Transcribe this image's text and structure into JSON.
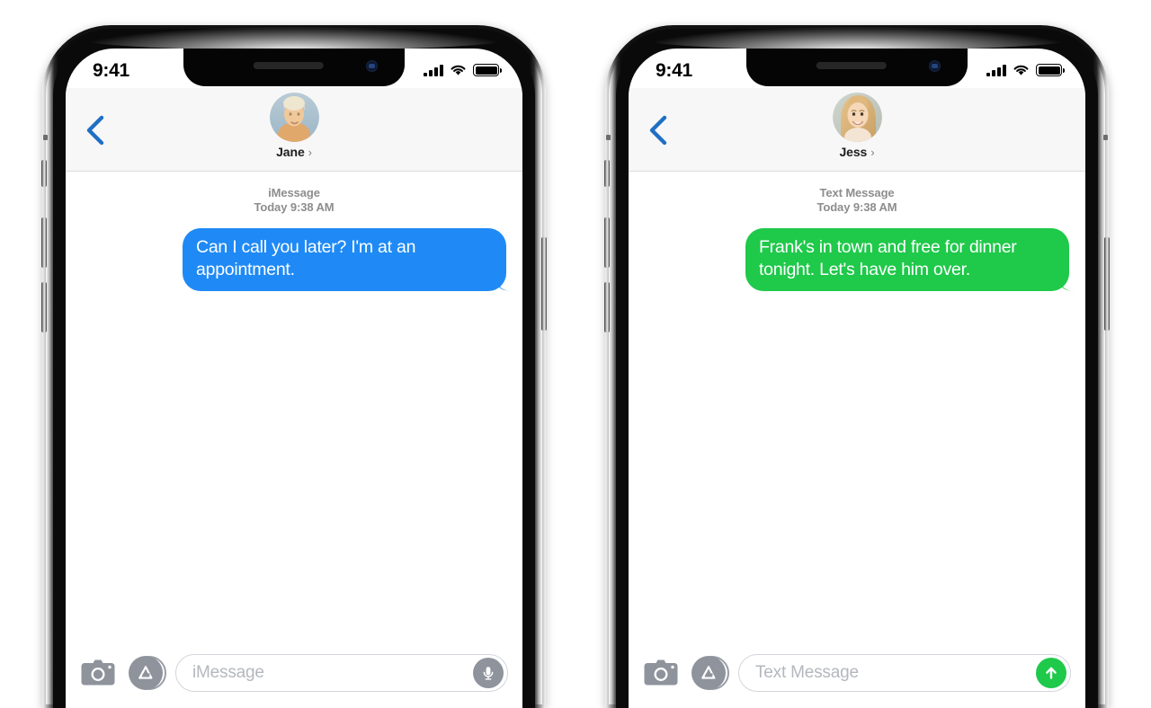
{
  "phones": [
    {
      "id": "phone-left",
      "status_bar": {
        "time": "9:41",
        "signal_icon": "cellular-signal-icon",
        "wifi_icon": "wifi-icon",
        "battery_icon": "battery-icon"
      },
      "navbar": {
        "back_icon": "back-chevron-icon",
        "contact_name": "Jane",
        "disclosure_chevron": "›",
        "avatar_icon": "contact-avatar"
      },
      "conversation": {
        "service_label": "iMessage",
        "timestamp": "Today 9:38 AM",
        "messages": [
          {
            "text": "Can I call you later? I'm at an appointment.",
            "direction": "outgoing",
            "style": "blue",
            "color": "#1f8af5"
          }
        ]
      },
      "toolbar": {
        "camera_icon": "camera-icon",
        "appstore_icon": "app-store-icon",
        "input_value": "",
        "input_placeholder": "iMessage",
        "action_icon": "microphone-icon",
        "action_kind": "mic"
      }
    },
    {
      "id": "phone-right",
      "status_bar": {
        "time": "9:41",
        "signal_icon": "cellular-signal-icon",
        "wifi_icon": "wifi-icon",
        "battery_icon": "battery-icon"
      },
      "navbar": {
        "back_icon": "back-chevron-icon",
        "contact_name": "Jess",
        "disclosure_chevron": "›",
        "avatar_icon": "contact-avatar"
      },
      "conversation": {
        "service_label": "Text Message",
        "timestamp": "Today 9:38 AM",
        "messages": [
          {
            "text": "Frank's in town and free for dinner tonight. Let's have him over.",
            "direction": "outgoing",
            "style": "green",
            "color": "#1fc94a"
          }
        ]
      },
      "toolbar": {
        "camera_icon": "camera-icon",
        "appstore_icon": "app-store-icon",
        "input_value": "",
        "input_placeholder": "Text Message",
        "action_icon": "send-arrow-icon",
        "action_kind": "send"
      }
    }
  ],
  "colors": {
    "imessage_blue": "#1f8af5",
    "sms_green": "#1fc94a",
    "nav_background": "#f7f7f7",
    "meta_text": "#8d8d8d",
    "back_chevron": "#1f6fc4",
    "tool_gray": "#8e939c"
  }
}
